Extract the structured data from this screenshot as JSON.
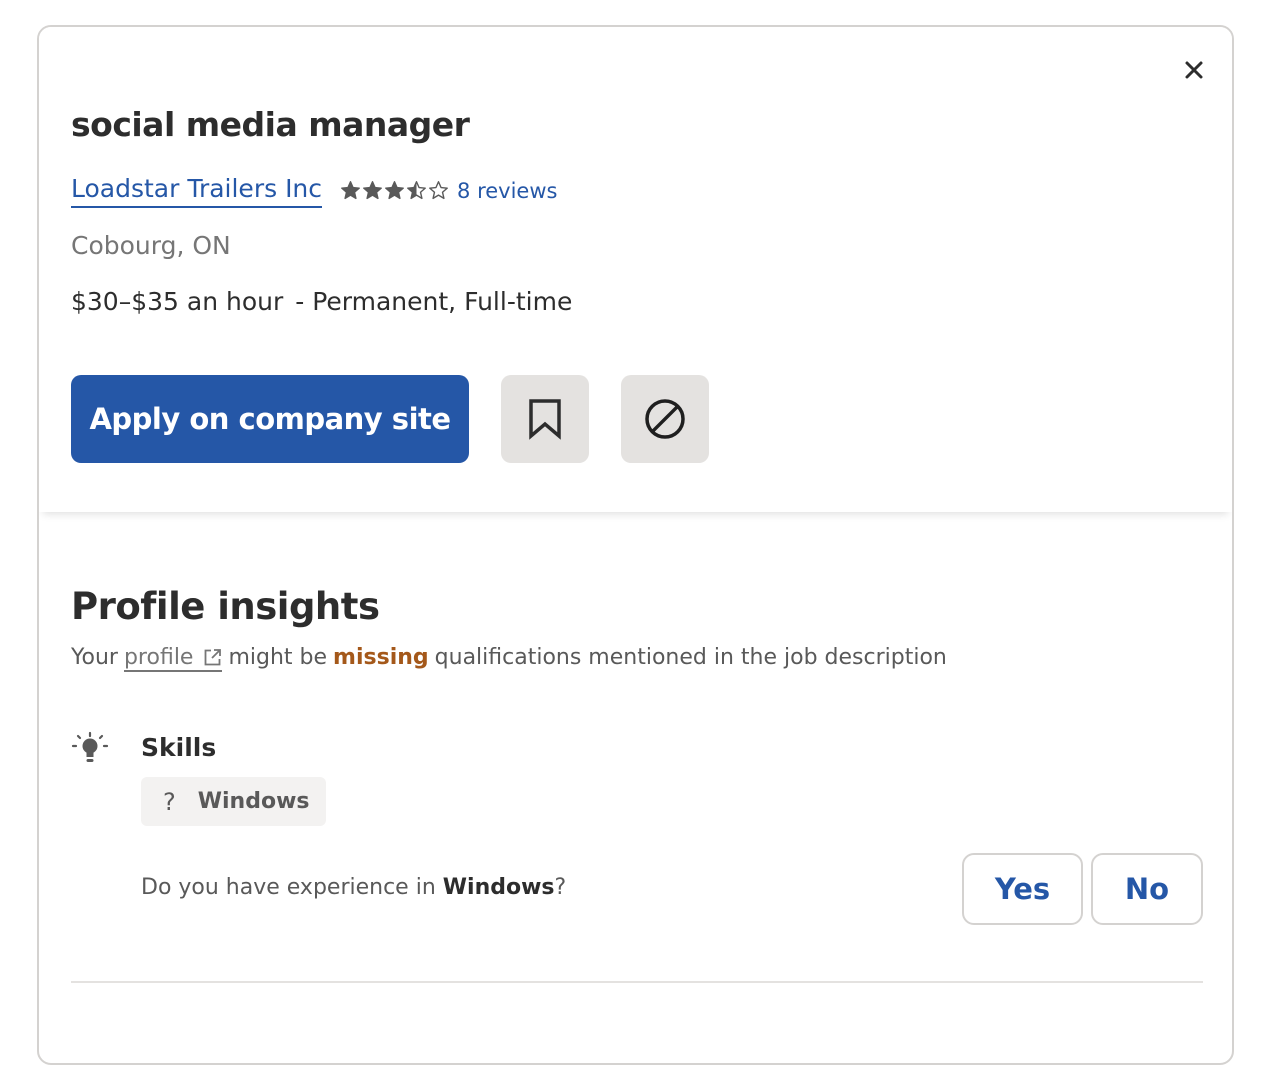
{
  "job": {
    "title": "social media manager",
    "company": "Loadstar Trailers Inc",
    "rating": 3.5,
    "rating_max": 5,
    "reviews_label": "8 reviews",
    "location": "Cobourg, ON",
    "salary": "$30–$35 an hour",
    "job_type": "- Permanent, Full-time"
  },
  "actions": {
    "apply_label": "Apply on company site",
    "save_icon": "bookmark-icon",
    "not_interested_icon": "ban-icon",
    "close_icon": "close-icon"
  },
  "insights": {
    "title": "Profile insights",
    "text_prefix": "Your",
    "profile_link": "profile",
    "text_mid": "might be",
    "missing": "missing",
    "text_suffix": "qualifications mentioned in the job description",
    "skills_label": "Skills",
    "skill_chip": "Windows",
    "skill_chip_prefix": "?",
    "question_prefix": "Do you have experience in",
    "question_skill": "Windows",
    "question_suffix": "?",
    "yes_label": "Yes",
    "no_label": "No"
  },
  "colors": {
    "primary": "#2557a7",
    "missing": "#a4581a",
    "text": "#2d2d2d",
    "muted": "#767676",
    "button_bg": "#e4e2e0"
  }
}
